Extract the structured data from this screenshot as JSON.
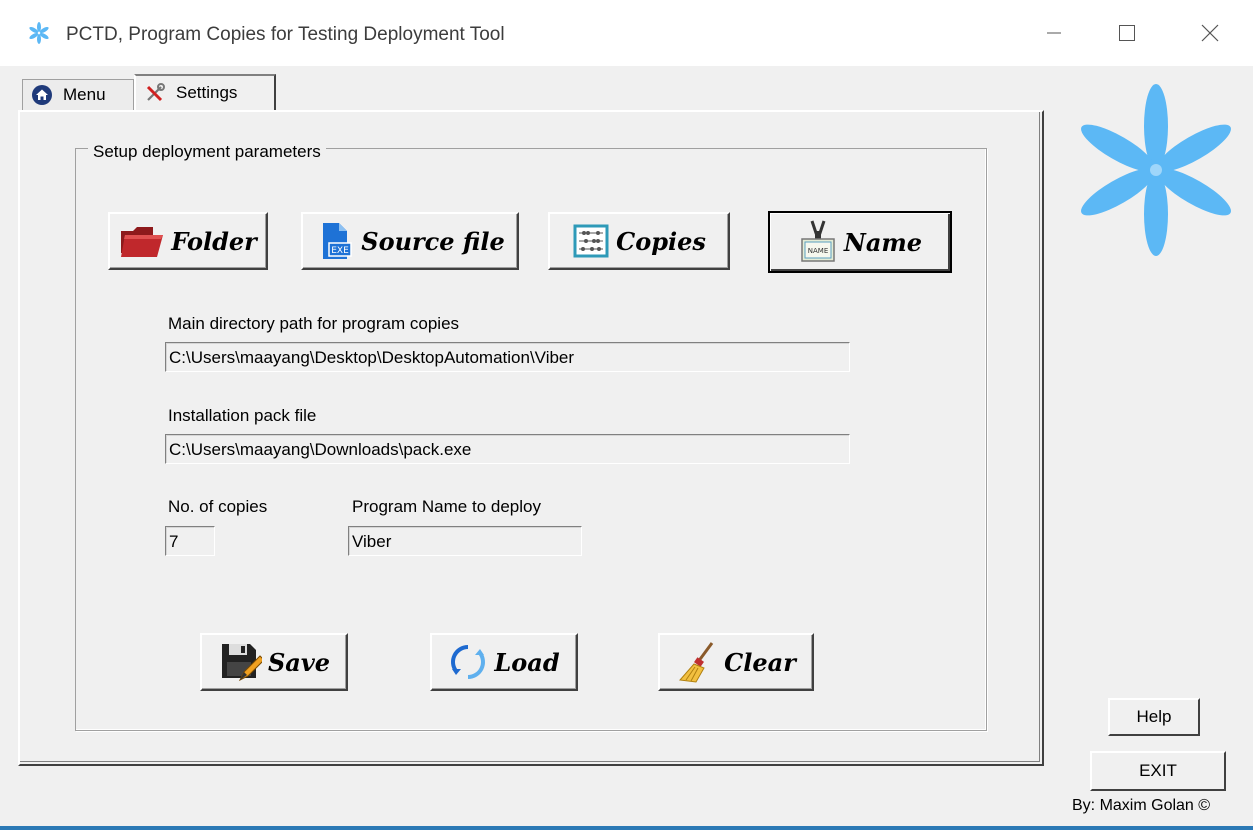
{
  "window": {
    "title": "PCTD, Program Copies for Testing Deployment Tool",
    "minimize_icon": "minimize-icon",
    "maximize_icon": "maximize-icon",
    "close_icon": "close-icon"
  },
  "tabs": [
    {
      "label": "Menu",
      "icon": "home-icon"
    },
    {
      "label": "Settings",
      "icon": "tools-icon",
      "active": true
    }
  ],
  "group": {
    "title": "Setup deployment parameters"
  },
  "buttons": {
    "folder": "Folder",
    "source_file": "Source file",
    "copies": "Copies",
    "name": "Name",
    "name_tag_text": "NAME",
    "save": "Save",
    "load": "Load",
    "clear": "Clear",
    "help": "Help",
    "exit": "EXIT"
  },
  "fields": {
    "main_dir_label": "Main directory path for program copies",
    "main_dir_value": "C:\\Users\\maayang\\Desktop\\DesktopAutomation\\Viber",
    "install_label": "Installation pack file",
    "install_value": "C:\\Users\\maayang\\Downloads\\pack.exe",
    "copies_label": "No. of copies",
    "copies_value": "7",
    "progname_label": "Program Name to deploy",
    "progname_value": "Viber"
  },
  "footer": {
    "author": "By: Maxim Golan ©"
  },
  "colors": {
    "logo_blue": "#5cb8f5",
    "window_bg": "#f0f0f0",
    "folder_red": "#c0282c",
    "exe_blue": "#1e72d6"
  }
}
